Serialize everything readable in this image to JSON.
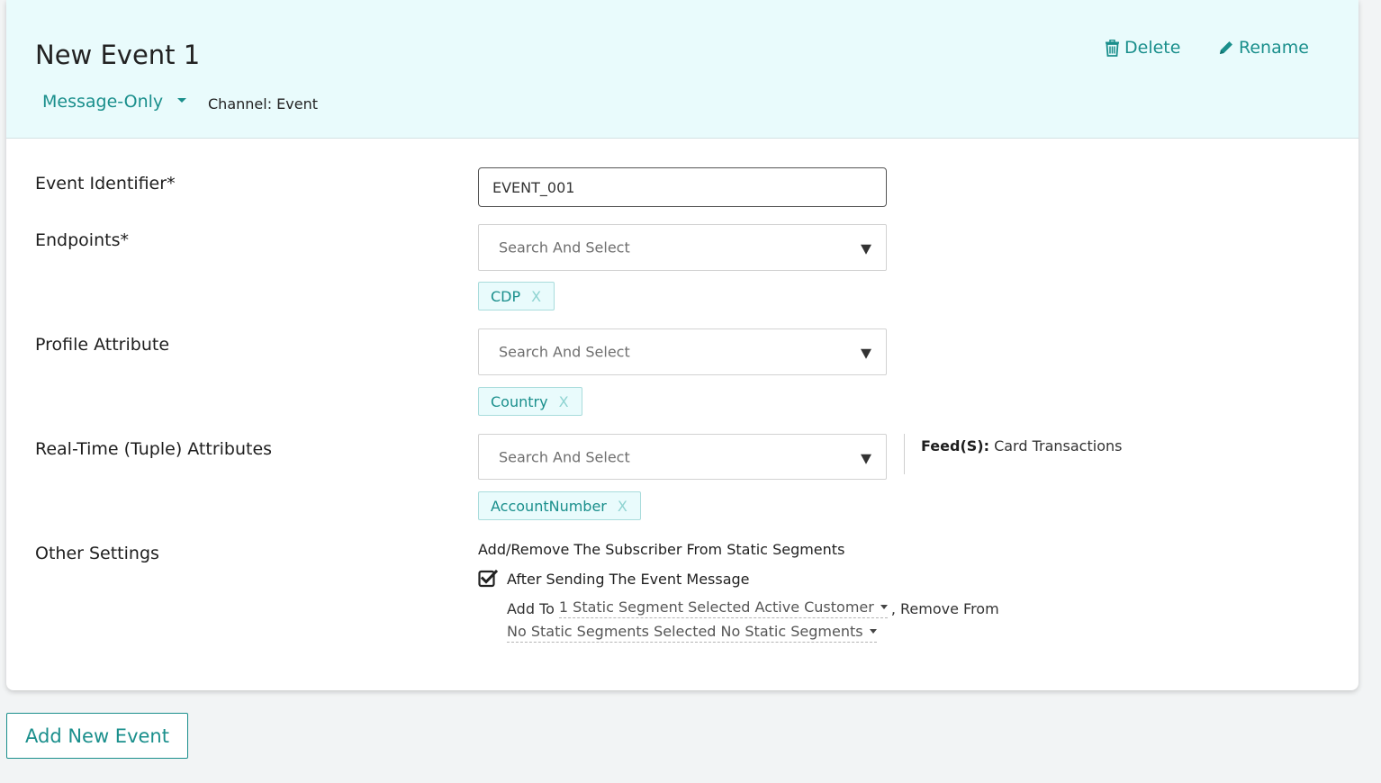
{
  "event": {
    "title": "New Event 1",
    "type_label": "Message-Only",
    "channel_text": "Channel: Event",
    "delete_label": "Delete",
    "rename_label": "Rename"
  },
  "form": {
    "event_identifier": {
      "label": "Event Identifier*",
      "value": "EVENT_001"
    },
    "endpoints": {
      "label": "Endpoints*",
      "placeholder": "Search And Select",
      "tags": [
        "CDP"
      ]
    },
    "profile_attribute": {
      "label": "Profile Attribute",
      "placeholder": "Search And Select",
      "tags": [
        "Country"
      ]
    },
    "realtime_attributes": {
      "label": "Real-Time (Tuple) Attributes",
      "placeholder": "Search And Select",
      "tags": [
        "AccountNumber"
      ],
      "feeds_label": "Feed(S):",
      "feeds_value": "Card Transactions"
    },
    "other_settings": {
      "label": "Other Settings",
      "heading": "Add/Remove The Subscriber From Static Segments",
      "after_send_label": "After Sending The Event Message",
      "after_send_checked": true,
      "add_to_label": "Add To",
      "add_to_value": "1 Static Segment Selected Active Customer",
      "remove_from_label": ", Remove From",
      "remove_from_value": "No Static Segments Selected No Static Segments"
    }
  },
  "tag_remove_glyph": "X",
  "add_event_label": "Add New Event",
  "colors": {
    "accent": "#1a8f8c",
    "header_bg": "#e9fbfc",
    "tag_bg": "#e9fbfc"
  }
}
